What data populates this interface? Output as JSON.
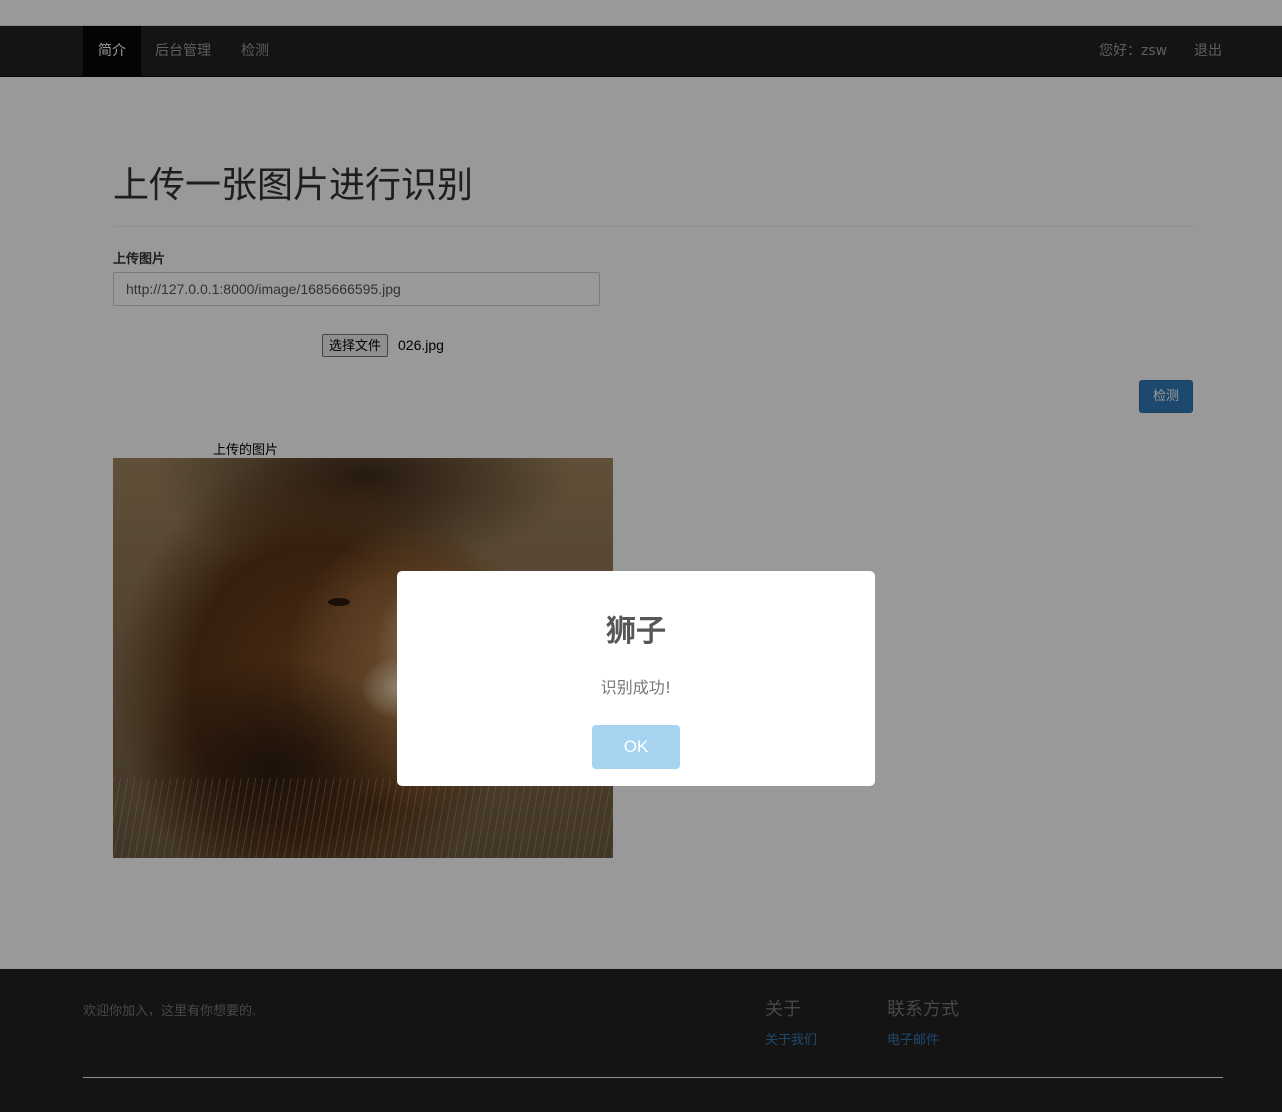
{
  "navbar": {
    "items": [
      {
        "label": "简介",
        "active": true
      },
      {
        "label": "后台管理",
        "active": false
      },
      {
        "label": "检测",
        "active": false
      }
    ],
    "greeting": "您好：zsw",
    "logout": "退出"
  },
  "main": {
    "title": "上传一张图片进行识别",
    "upload_label": "上传图片",
    "image_url_value": "http://127.0.0.1:8000/image/1685666595.jpg",
    "file_button_label": "选择文件",
    "file_name": "026.jpg",
    "detect_button_label": "检测",
    "image_caption": "上传的图片"
  },
  "footer": {
    "welcome": "欢迎你加入，这里有你想要的.",
    "about_heading": "关于",
    "about_link": "关于我们",
    "contact_heading": "联系方式",
    "contact_link": "电子邮件"
  },
  "dialog": {
    "title": "狮子",
    "message": "识别成功!",
    "ok_label": "OK"
  },
  "colors": {
    "navbar_bg": "#222222",
    "primary": "#337ab7",
    "ok_button": "#a5d3f0",
    "overlay": "rgba(0,0,0,0.4)"
  }
}
